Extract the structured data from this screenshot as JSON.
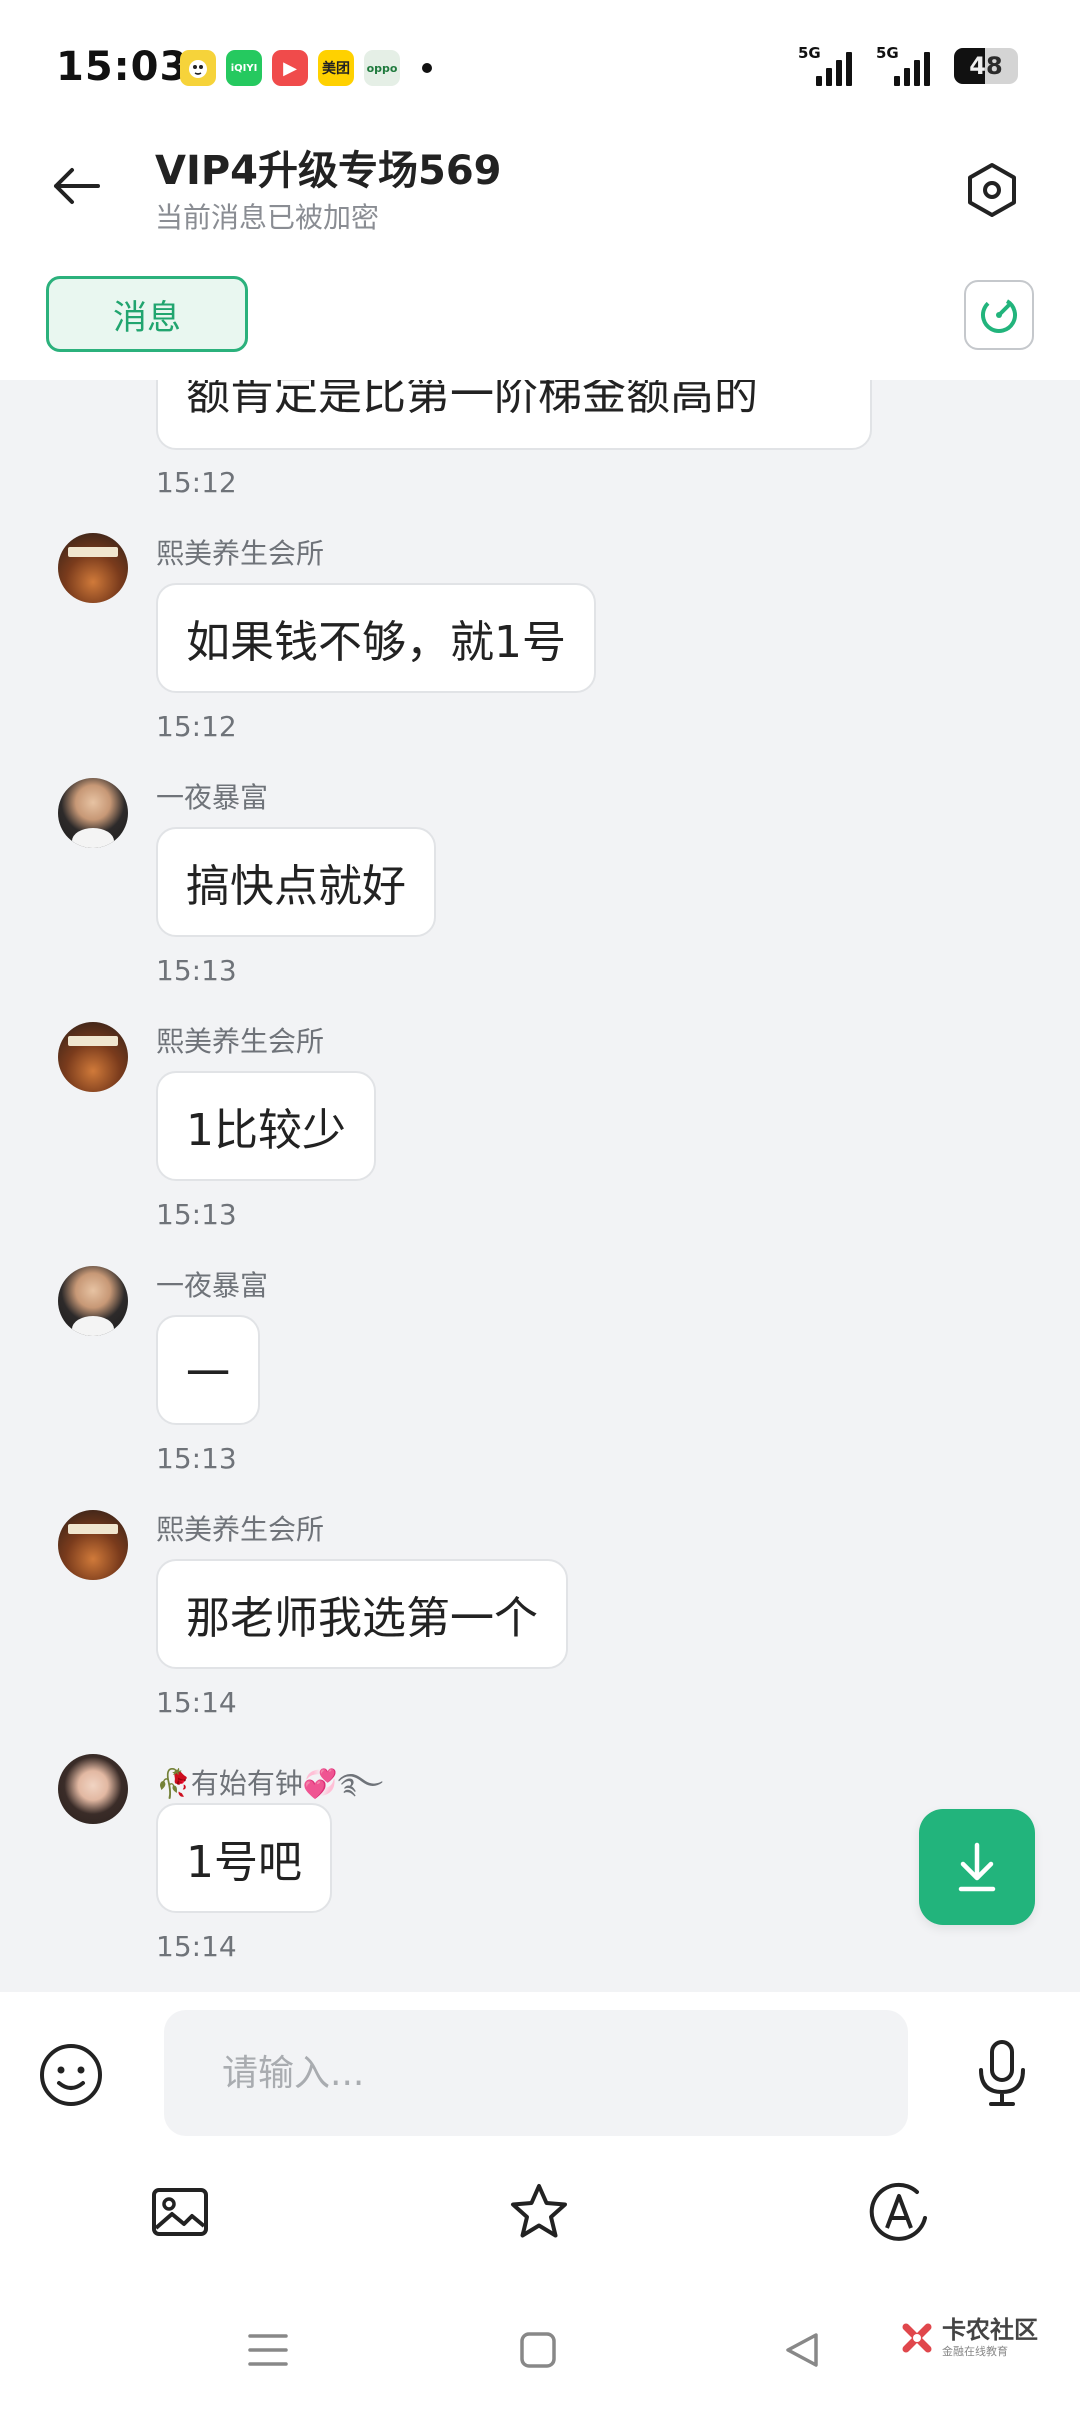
{
  "status_bar": {
    "time": "15:03",
    "app_icons": [
      {
        "name": "bird-app-icon",
        "text": "",
        "color": "#f6d33a"
      },
      {
        "name": "iqiyi-app-icon",
        "text": "iQIYI",
        "color": "#25c95f"
      },
      {
        "name": "video-app-icon",
        "text": "▶",
        "color": "#f04b4b"
      },
      {
        "name": "meituan-app-icon",
        "text": "美团",
        "color": "#ffd100"
      },
      {
        "name": "oppo-app-icon",
        "text": "oppo",
        "color": "#e5efe6"
      }
    ],
    "signal1_label": "5G",
    "signal2_label": "5G",
    "battery": "48"
  },
  "header": {
    "title": "VIP4升级专场569",
    "subtitle": "当前消息已被加密"
  },
  "tabs": {
    "messages_label": "消息"
  },
  "chat": {
    "partial_bubble": "额肯定是比第一阶梯金额高的",
    "partial_time": "15:12",
    "messages": [
      {
        "sender": "熙美养生会所",
        "text": "如果钱不够，就1号",
        "time": "15:12",
        "avatar": "shop"
      },
      {
        "sender": "一夜暴富",
        "text": "搞快点就好",
        "time": "15:13",
        "avatar": "man"
      },
      {
        "sender": "熙美养生会所",
        "text": "1比较少",
        "time": "15:13",
        "avatar": "shop"
      },
      {
        "sender": "一夜暴富",
        "text": "一",
        "time": "15:13",
        "avatar": "man"
      },
      {
        "sender": "熙美养生会所",
        "text": "那老师我选第一个",
        "time": "15:14",
        "avatar": "shop"
      },
      {
        "sender": "🥀有始有钟💞࿐",
        "text": "1号吧",
        "time": "15:14",
        "avatar": "woman"
      }
    ]
  },
  "input": {
    "placeholder": "请输入..."
  },
  "watermark": {
    "main": "卡农社区",
    "sub": "金融在线教育"
  },
  "colors": {
    "accent": "#22b47c",
    "tab_border": "#2bb17c",
    "chat_bg": "#f2f3f5"
  }
}
